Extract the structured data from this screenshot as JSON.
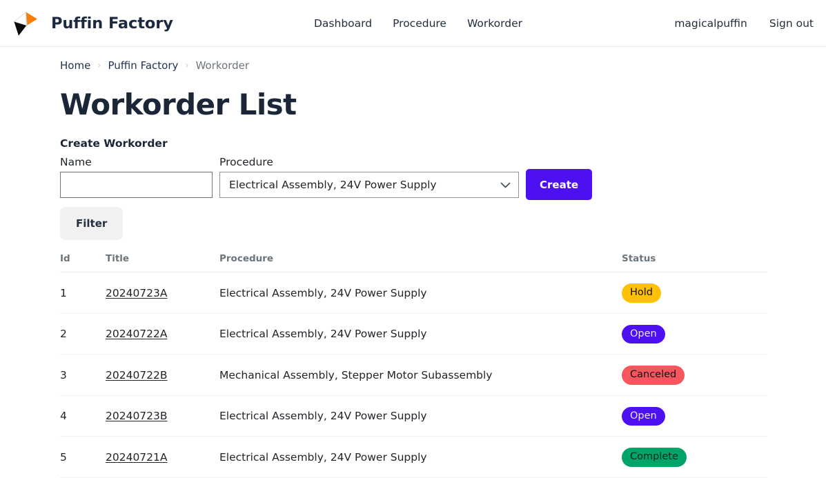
{
  "navbar": {
    "brand": "Puffin Factory",
    "logo_icon": "puffin-kite-logo",
    "center_links": [
      {
        "label": "Dashboard"
      },
      {
        "label": "Procedure"
      },
      {
        "label": "Workorder"
      }
    ],
    "right_links": [
      {
        "label": "magicalpuffin"
      },
      {
        "label": "Sign out"
      }
    ]
  },
  "breadcrumb": {
    "items": [
      {
        "label": "Home",
        "current": false
      },
      {
        "label": "Puffin Factory",
        "current": false
      },
      {
        "label": "Workorder",
        "current": true
      }
    ],
    "separator": "›"
  },
  "page": {
    "title": "Workorder List",
    "section_label": "Create Workorder"
  },
  "create_form": {
    "name_label": "Name",
    "name_value": "",
    "name_placeholder": "",
    "procedure_label": "Procedure",
    "procedure_selected": "Electrical Assembly, 24V Power Supply",
    "procedure_options": [
      "Electrical Assembly, 24V Power Supply",
      "Mechanical Assembly, Stepper Motor Subassembly"
    ],
    "chevron_icon": "chevron-down-icon",
    "create_label": "Create"
  },
  "filter": {
    "label": "Filter"
  },
  "table": {
    "columns": [
      "Id",
      "Title",
      "Procedure",
      "Status"
    ],
    "rows": [
      {
        "id": "1",
        "title": "20240723A",
        "procedure": "Electrical Assembly, 24V Power Supply",
        "status": "Hold",
        "status_kind": "hold"
      },
      {
        "id": "2",
        "title": "20240722A",
        "procedure": "Electrical Assembly, 24V Power Supply",
        "status": "Open",
        "status_kind": "open"
      },
      {
        "id": "3",
        "title": "20240722B",
        "procedure": "Mechanical Assembly, Stepper Motor Subassembly",
        "status": "Canceled",
        "status_kind": "canceled"
      },
      {
        "id": "4",
        "title": "20240723B",
        "procedure": "Electrical Assembly, 24V Power Supply",
        "status": "Open",
        "status_kind": "open"
      },
      {
        "id": "5",
        "title": "20240721A",
        "procedure": "Electrical Assembly, 24V Power Supply",
        "status": "Complete",
        "status_kind": "complete"
      }
    ]
  },
  "colors": {
    "accent_purple": "#4d10f0",
    "status_hold": "#ffc107",
    "status_open": "#4d10f0",
    "status_canceled": "#f8565f",
    "status_complete": "#00a368",
    "logo_orange": "#f97d09",
    "logo_black": "#0c0c0c",
    "brand_text": "#1b2a41"
  }
}
